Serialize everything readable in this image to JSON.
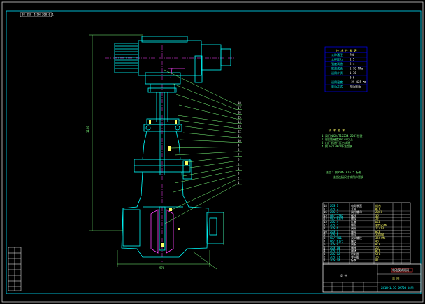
{
  "drawing": {
    "code_tag": "08-ZGS-Z41H-300 0-1",
    "dims": {
      "height": "1120",
      "width": "978"
    },
    "callouts": [
      "18",
      "17",
      "16",
      "15",
      "14",
      "13",
      "12",
      "11",
      "10",
      "9",
      "8",
      "7",
      "6",
      "5",
      "4",
      "3",
      "2",
      "1"
    ],
    "spec_table": {
      "title": "技 术 性 能 表",
      "rows": [
        {
          "label": "公称通径",
          "value": "700"
        },
        {
          "label": "公称压力",
          "value": "1.5"
        },
        {
          "label": "强度试验",
          "value": "2.4"
        },
        {
          "label": "密封试验",
          "value": "1.76 MPa"
        },
        {
          "label": "适用介质",
          "value": "1.76"
        },
        {
          "label": "",
          "value": "0.6"
        },
        {
          "label": "适用温度",
          "value": "-29~425 ℃"
        },
        {
          "label": "驱动方式",
          "value": "电动驱动"
        }
      ]
    },
    "notes": {
      "title": "技 术 要 求",
      "lines": [
        "1.阀门按GB/T12234-2007检验",
        "2.密封面硬度HRC40以上",
        "3.出厂前进行压力试验",
        "4.按JB/T7928标准包装"
      ]
    },
    "flange_note": [
      "法兰: 按ASME B16.5 标准",
      "法兰连接尺寸按用户要求"
    ],
    "bom_rows": [
      {
        "no": "18",
        "code": "ZGS-1",
        "name": "电动装置",
        "mat": "组合"
      },
      {
        "no": "17",
        "code": "ZGS-2",
        "name": "支架",
        "mat": "WCB"
      },
      {
        "no": "16",
        "code": "ZGS-3",
        "name": "阀杆螺母",
        "mat": "ZQAl"
      },
      {
        "no": "15",
        "code": "GB/T5782",
        "name": "螺栓",
        "mat": "35"
      },
      {
        "no": "14",
        "code": "GB/T6170",
        "name": "螺母",
        "mat": "25"
      },
      {
        "no": "13",
        "code": "ZGS-4",
        "name": "压盖",
        "mat": "WCB"
      },
      {
        "no": "12",
        "code": "ZGS-5",
        "name": "填料",
        "mat": "柔性石墨"
      },
      {
        "no": "11",
        "code": "ZGS-6",
        "name": "阀杆",
        "mat": "2Cr13"
      },
      {
        "no": "10",
        "code": "ZGS-7",
        "name": "阀盖",
        "mat": "WCB"
      },
      {
        "no": "9",
        "code": "ZGS-8",
        "name": "垫片",
        "mat": "不锈钢"
      },
      {
        "no": "8",
        "code": "GB/T901",
        "name": "双头螺柱",
        "mat": "35CrMo"
      },
      {
        "no": "7",
        "code": "GB/T6175",
        "name": "螺母",
        "mat": "45"
      },
      {
        "no": "6",
        "code": "ZGS-9",
        "name": "闸板",
        "mat": "WCB"
      },
      {
        "no": "5",
        "code": "ZGS-10",
        "name": "阀座",
        "mat": "25"
      },
      {
        "no": "4",
        "code": "ZGS-11",
        "name": "阀体",
        "mat": "WCB"
      },
      {
        "no": "3",
        "code": "ZGS-12",
        "name": "密封圈",
        "mat": "STL"
      },
      {
        "no": "2",
        "code": "ZGS-13",
        "name": "导向板",
        "mat": "25"
      },
      {
        "no": "1",
        "code": "ZGS-14",
        "name": "标牌",
        "mat": "Al"
      }
    ],
    "title_block": {
      "product": "电动楔式闸阀",
      "sheet": "总 图",
      "drawing_no": "Z41H-1.5C DN700 总图",
      "company": "设 计"
    }
  },
  "colors": {
    "frame": "#00e0ff",
    "body": "#00ffff",
    "dim": "#7dff7d",
    "callout": "#7dff7d",
    "magenta": "#ff40ff",
    "table": "#0000ff",
    "text": "#ffffff"
  }
}
